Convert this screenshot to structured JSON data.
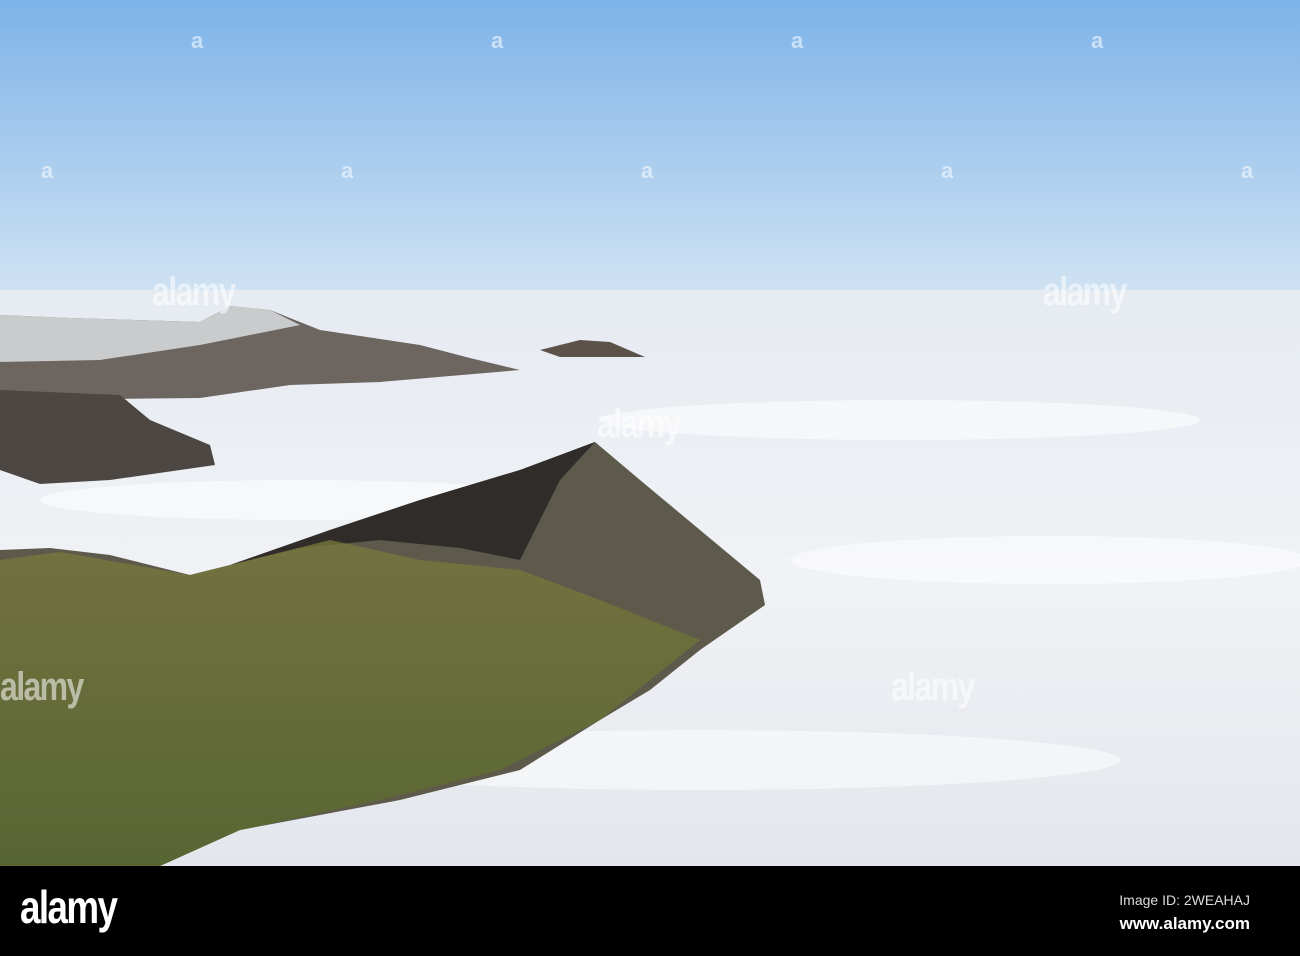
{
  "photo": {
    "subject": "mountain ridge above cloud inversion"
  },
  "watermark": {
    "text": "alamy",
    "mark": "a"
  },
  "footer": {
    "logo": "alamy",
    "image_id": "Image ID: 2WEAHAJ",
    "website": "www.alamy.com"
  }
}
